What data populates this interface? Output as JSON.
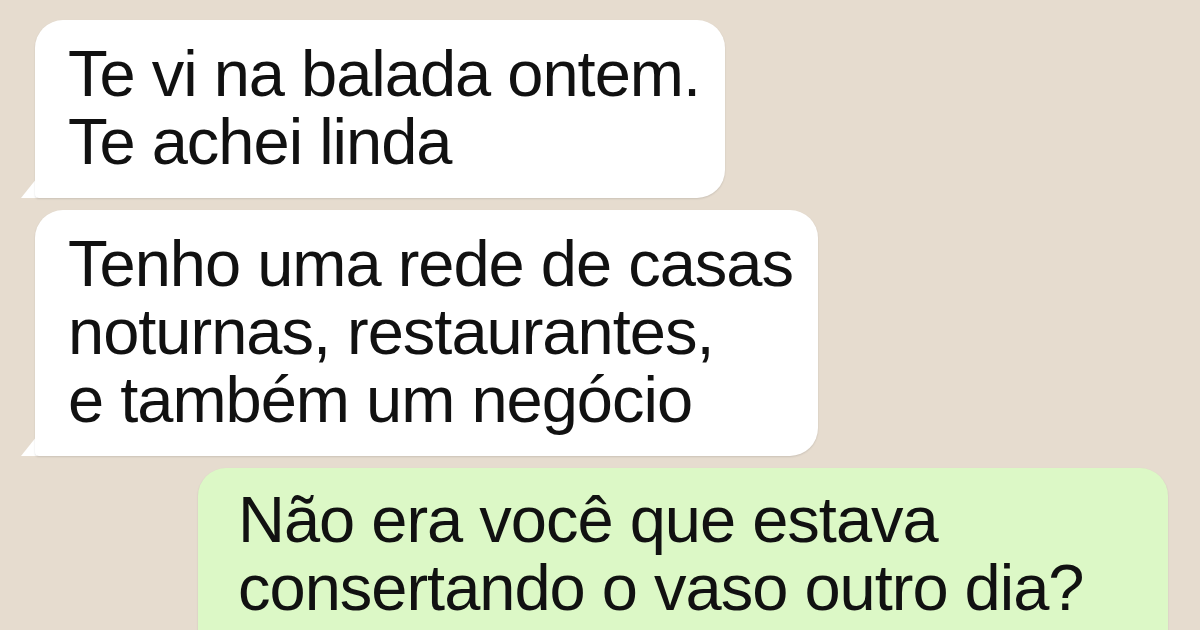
{
  "messages": [
    {
      "kind": "incoming",
      "lines": [
        "Te vi na balada ontem.",
        "Te achei linda"
      ]
    },
    {
      "kind": "incoming",
      "lines": [
        "Tenho uma rede de casas",
        "noturnas, restaurantes,",
        "e também um negócio"
      ]
    },
    {
      "kind": "outgoing",
      "lines": [
        "Não era você que estava",
        "consertando o vaso outro dia?"
      ]
    }
  ]
}
